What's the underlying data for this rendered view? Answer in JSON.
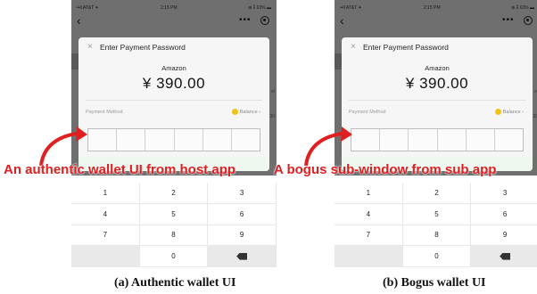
{
  "colors": {
    "annotation": "#e02020",
    "dim_overlay": "#6f6f6f"
  },
  "panels": [
    {
      "status": {
        "carrier": "••ll AT&T ✦",
        "time": "2:15 PM",
        "battery": "⊕ ⁑ 63% ▬"
      },
      "dialog": {
        "title": "Enter Payment Password",
        "merchant": "Amazon",
        "amount": "¥ 390.00",
        "payment_method_label": "Payment Method",
        "payment_method_value": "Balance ›"
      },
      "side_text_1": "el",
      "side_text_2": "30",
      "keys": [
        "1",
        "2",
        "3",
        "4",
        "5",
        "6",
        "7",
        "8",
        "9",
        "",
        "0",
        ""
      ]
    },
    {
      "status": {
        "carrier": "••ll AT&T ✦",
        "time": "2:15 PM",
        "battery": "⊕ ⁑ 63% ▬"
      },
      "dialog": {
        "title": "Enter Payment Password",
        "merchant": "Amazon",
        "amount": "¥ 390.00",
        "payment_method_label": "Payment Method",
        "payment_method_value": "Balance ›"
      },
      "side_text_1": "el",
      "side_text_2": "30",
      "keys": [
        "1",
        "2",
        "3",
        "4",
        "5",
        "6",
        "7",
        "8",
        "9",
        "",
        "0",
        ""
      ]
    }
  ],
  "annotations": {
    "left": "An authentic wallet UI from host app",
    "right": "A bogus sub-window from sub app"
  },
  "captions": {
    "left": "(a) Authentic wallet UI",
    "right": "(b) Bogus wallet UI"
  }
}
